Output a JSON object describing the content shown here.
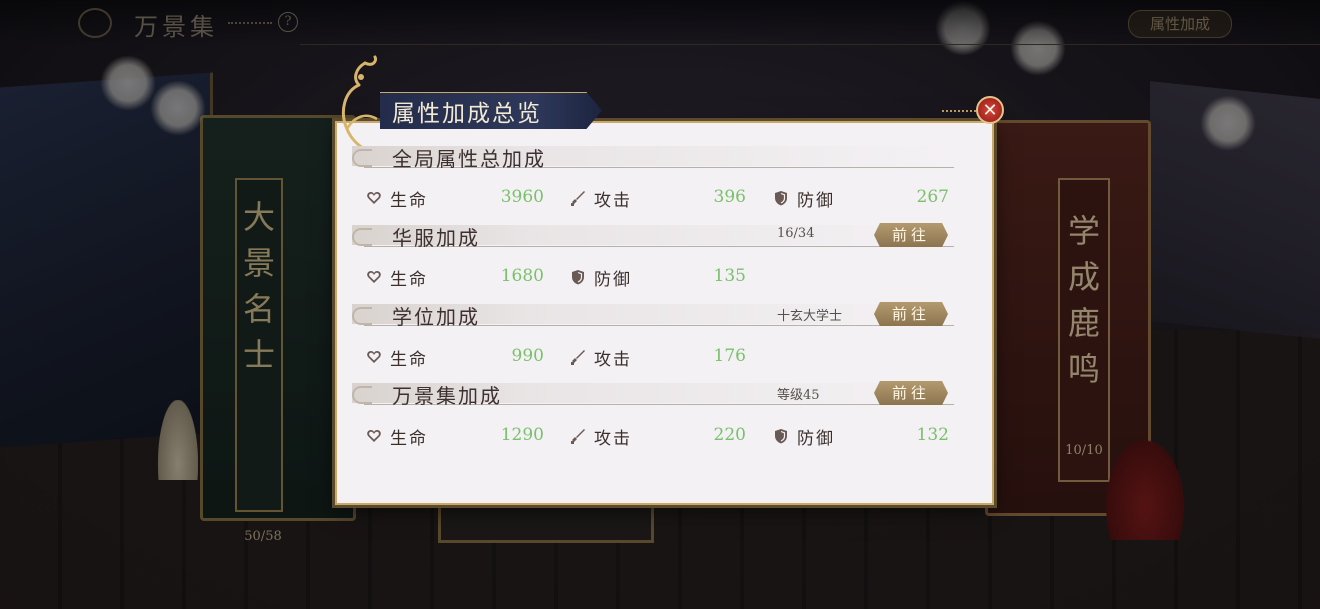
{
  "top_bar": {
    "title": "万景集",
    "help_icon": "?",
    "right_button": "属性加成"
  },
  "background_books": {
    "left": {
      "title": "大景名士",
      "count": "50/58"
    },
    "right": {
      "title": "学成鹿鸣",
      "count": "10/10"
    }
  },
  "dialog": {
    "title": "属性加成总览",
    "close_icon": "✕",
    "sections": [
      {
        "title": "全局属性总加成",
        "meta": "",
        "goto": "",
        "stats": [
          {
            "label": "生命",
            "value": "3960",
            "icon": "heart-icon"
          },
          {
            "label": "攻击",
            "value": "396",
            "icon": "sword-icon"
          },
          {
            "label": "防御",
            "value": "267",
            "icon": "shield-icon"
          }
        ]
      },
      {
        "title": "华服加成",
        "meta": "16/34",
        "goto": "前往",
        "stats": [
          {
            "label": "生命",
            "value": "1680",
            "icon": "heart-icon"
          },
          {
            "label": "防御",
            "value": "135",
            "icon": "shield-icon"
          }
        ]
      },
      {
        "title": "学位加成",
        "meta": "十玄大学士",
        "goto": "前往",
        "stats": [
          {
            "label": "生命",
            "value": "990",
            "icon": "heart-icon"
          },
          {
            "label": "攻击",
            "value": "176",
            "icon": "sword-icon"
          }
        ]
      },
      {
        "title": "万景集加成",
        "meta": "等级45",
        "goto": "前往",
        "stats": [
          {
            "label": "生命",
            "value": "1290",
            "icon": "heart-icon"
          },
          {
            "label": "攻击",
            "value": "220",
            "icon": "sword-icon"
          },
          {
            "label": "防御",
            "value": "132",
            "icon": "shield-icon"
          }
        ]
      }
    ]
  },
  "colors": {
    "value_green": "#79c16b",
    "gold": "#c8a96a",
    "title_navy": "#232c4a"
  }
}
